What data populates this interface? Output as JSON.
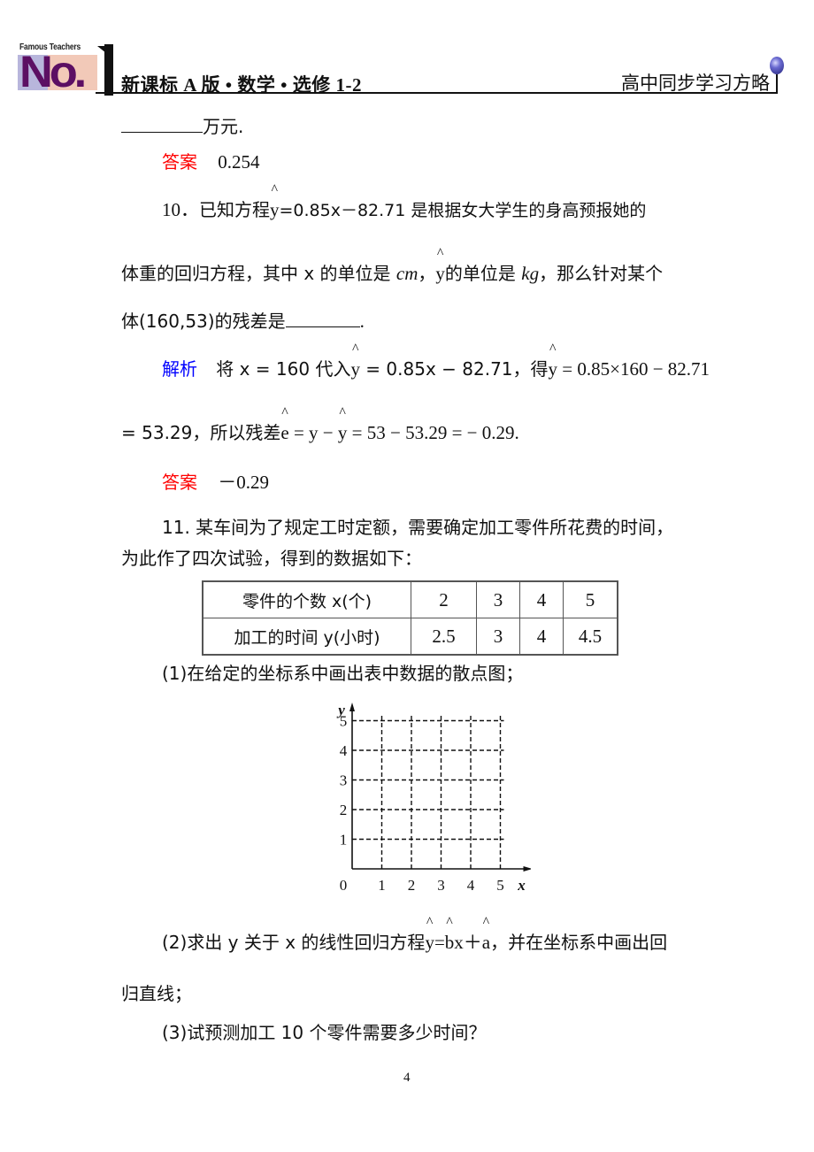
{
  "header": {
    "logo_tagline": "Famous Teachers",
    "logo_text": "No.",
    "left_title": "新课标 A 版 • 数学 • 选修 1-2",
    "right_title": "高中同步学习方略"
  },
  "prev_question": {
    "tail_text": "万元.",
    "answer_label": "答案",
    "answer_value": "0.254"
  },
  "q10": {
    "number": "10．",
    "line1_a": "已知方程",
    "line1_hat_y": "y",
    "line1_b": "=0.85x－82.71 是根据女大学生的身高预报她的",
    "line2_a": "体重的回归方程，其中 x 的单位是 ",
    "line2_cm": "cm",
    "line2_b": "，",
    "line2_hat_y": "y",
    "line2_c": "的单位是 ",
    "line2_kg": "kg",
    "line2_d": "，那么针对某个",
    "line3_a": "体(160,53)的残差是",
    "line3_b": ".",
    "analysis_label": "解析",
    "analysis_1a": "将 x = 160 代入",
    "analysis_1_hat_y": "y",
    "analysis_1b": " = 0.85x − 82.71，得",
    "analysis_1_hat_y2": "y",
    "analysis_1c": " = 0.85×160 − 82.71",
    "analysis_2a": "= 53.29，所以残差",
    "analysis_2_hat_e": "e",
    "analysis_2b": " = y − ",
    "analysis_2_hat_y": "y",
    "analysis_2c": " = 53 − 53.29 = − 0.29.",
    "answer_label": "答案",
    "answer_value": "－0.29"
  },
  "q11": {
    "line1": "11. 某车间为了规定工时定额，需要确定加工零件所花费的时间，",
    "line2": "为此作了四次试验，得到的数据如下：",
    "table": {
      "rows": [
        {
          "label": "零件的个数 x(个)",
          "values": [
            "2",
            "3",
            "4",
            "5"
          ]
        },
        {
          "label": "加工的时间 y(小时)",
          "values": [
            "2.5",
            "3",
            "4",
            "4.5"
          ]
        }
      ]
    },
    "part1": "(1)在给定的坐标系中画出表中数据的散点图；",
    "part2_a": "(2)求出 y 关于 x 的线性回归方程",
    "part2_y": "y",
    "part2_eq": "=",
    "part2_b": "b",
    "part2_x": "x＋",
    "part2_a_hat": "a",
    "part2_c": "，并在坐标系中画出回",
    "part2_line2": "归直线；",
    "part3": "(3)试预测加工 10 个零件需要多少时间？"
  },
  "chart_data": {
    "type": "scatter",
    "title": "",
    "xlabel": "x",
    "ylabel": "y",
    "origin_label": "0",
    "x_ticks": [
      "1",
      "2",
      "3",
      "4",
      "5"
    ],
    "y_ticks": [
      "1",
      "2",
      "3",
      "4",
      "5"
    ],
    "xlim": [
      0,
      5
    ],
    "ylim": [
      0,
      5
    ],
    "grid": "dashed",
    "points": []
  },
  "page_number": "4"
}
